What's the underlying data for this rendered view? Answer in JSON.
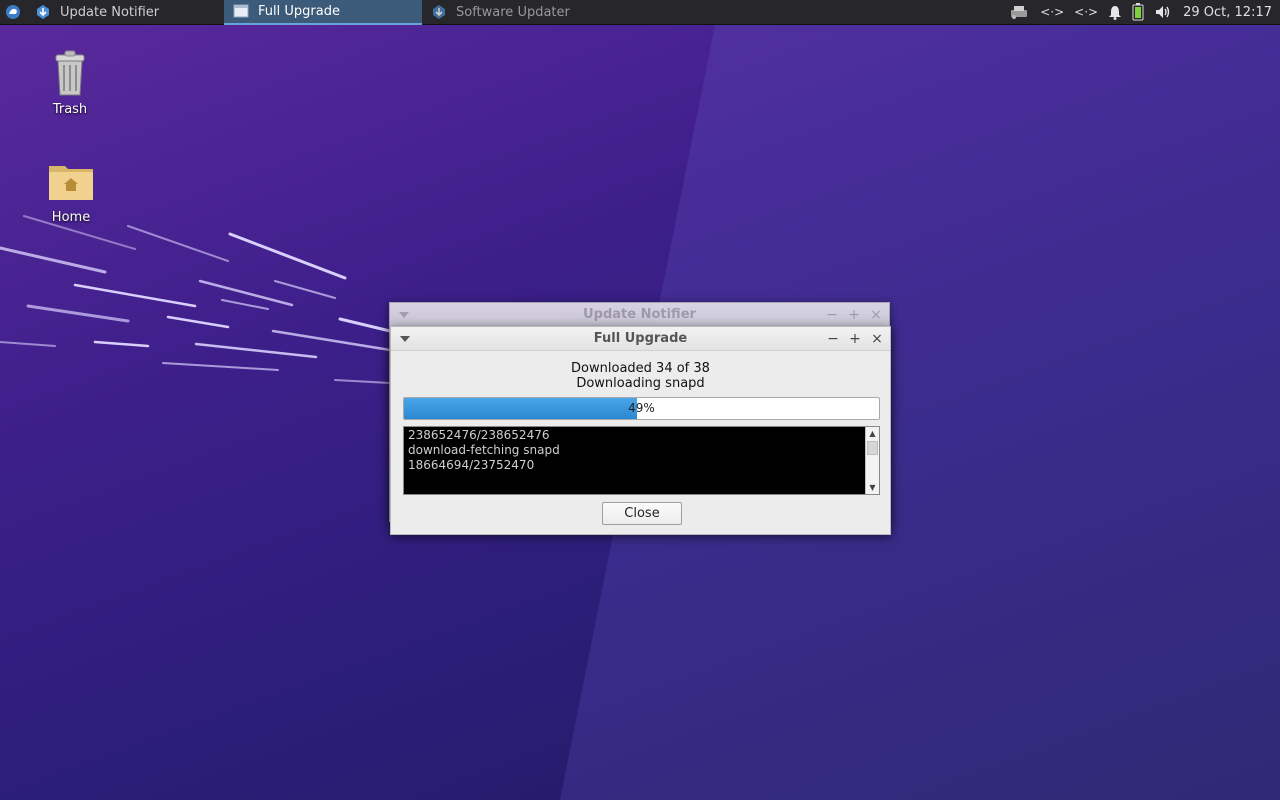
{
  "panel": {
    "tasks": [
      {
        "label": "Update Notifier",
        "icon": "update-notifier-icon"
      },
      {
        "label": "Full Upgrade",
        "icon": "window-icon"
      },
      {
        "label": "Software Updater",
        "icon": "software-updater-icon"
      }
    ],
    "active_task": "Full Upgrade",
    "tray": {
      "network_a": "<·>",
      "network_b": "<·>",
      "clock": "29 Oct, 12:17"
    }
  },
  "desktop": {
    "icons": [
      {
        "label": "Trash",
        "icon": "trash-icon"
      },
      {
        "label": "Home",
        "icon": "home-folder-icon"
      }
    ]
  },
  "back_window": {
    "title": "Update Notifier"
  },
  "upgrade_window": {
    "title": "Full Upgrade",
    "status_line1": "Downloaded 34 of 38",
    "status_line2": "Downloading snapd",
    "progress_text": "49%",
    "progress": 0.49,
    "terminal_lines": [
      "238652476/238652476",
      "download-fetching snapd",
      "18664694/23752470"
    ],
    "close_label": "Close"
  },
  "colors": {
    "panel_bg": "#26262b",
    "active_task_bg": "#3c5a7a",
    "progress_fill": "#2a88d2",
    "desktop_purple": "#3d1f8a"
  }
}
